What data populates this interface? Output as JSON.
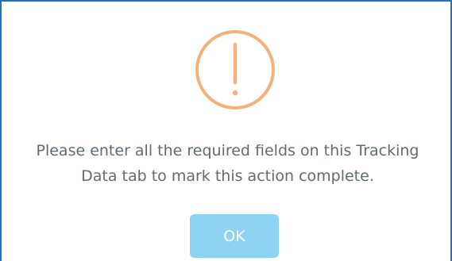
{
  "dialog": {
    "message_line_1": "Please enter all the required fields on this Tracking",
    "message_line_2": "Data tab to mark this action complete.",
    "ok_label": "OK",
    "icon": "exclamation-circle-icon"
  },
  "colors": {
    "border": "#1a73c9",
    "icon": "#f2b27a",
    "message_text": "#5f6b73",
    "button_bg": "#8fd3f3",
    "button_text": "#ffffff"
  }
}
